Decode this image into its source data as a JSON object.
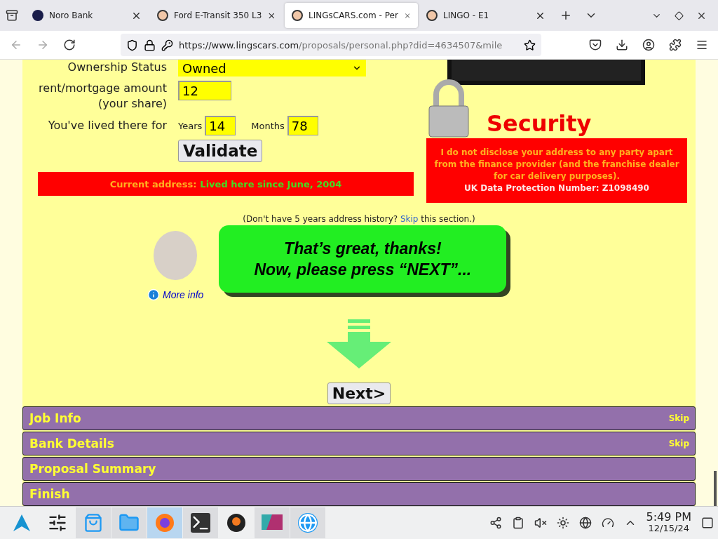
{
  "browser": {
    "tabs": [
      {
        "title": "Noro Bank",
        "kind": "bank",
        "selected": false
      },
      {
        "title": "Ford E-Transit 350 L3",
        "kind": "face",
        "selected": false
      },
      {
        "title": "LINGsCARS.com - Per",
        "kind": "face",
        "selected": true
      },
      {
        "title": "LINGO - E1",
        "kind": "face",
        "selected": false
      }
    ],
    "url_host": "https://www.lingscars.com",
    "url_path": "/proposals/personal.php?did=4634507&mile"
  },
  "form": {
    "ownership_label": "Ownership Status",
    "ownership_value": "Owned",
    "rent_label": "rent/mortgage amount",
    "rent_sublabel": "(your share)",
    "rent_value": "12",
    "lived_label": "You've lived there for",
    "years_label": "Years",
    "years_value": "14",
    "months_label": "Months",
    "months_value": "78",
    "validate": "Validate"
  },
  "current_address": {
    "label": "Current address:",
    "value": "Lived here since June, 2004"
  },
  "security": {
    "title": "Security",
    "text": "I do not disclose your address to any party apart from the finance provider (and the franchise dealer for car delivery purposes).",
    "dp_number": "UK Data Protection Number: Z1098490"
  },
  "skip_note": {
    "before": "(Don't have 5 years address history?",
    "link": "Skip",
    "after": "this section.)"
  },
  "bubble": {
    "lines": [
      "That’s great, thanks!",
      "Now, please press “NEXT”..."
    ]
  },
  "more_info": "More info",
  "next_button": "Next>",
  "sections": [
    {
      "title": "Job Info",
      "skip": "Skip"
    },
    {
      "title": "Bank Details",
      "skip": "Skip"
    },
    {
      "title": "Proposal Summary"
    },
    {
      "title": "Finish"
    }
  ],
  "taskbar": {
    "apps": [
      {
        "kind": "launcher",
        "running": false,
        "selected": false
      },
      {
        "kind": "mixer",
        "running": false,
        "selected": false
      },
      {
        "kind": "store",
        "running": true,
        "selected": false
      },
      {
        "kind": "folder",
        "running": true,
        "selected": false
      },
      {
        "kind": "browser",
        "running": true,
        "selected": true
      },
      {
        "kind": "terminal",
        "running": true,
        "selected": false
      },
      {
        "kind": "vm",
        "running": false,
        "selected": false
      },
      {
        "kind": "remote",
        "running": true,
        "selected": false
      },
      {
        "kind": "globe",
        "running": true,
        "selected": false
      }
    ],
    "time": "5:49 PM",
    "date": "12/15/24"
  }
}
